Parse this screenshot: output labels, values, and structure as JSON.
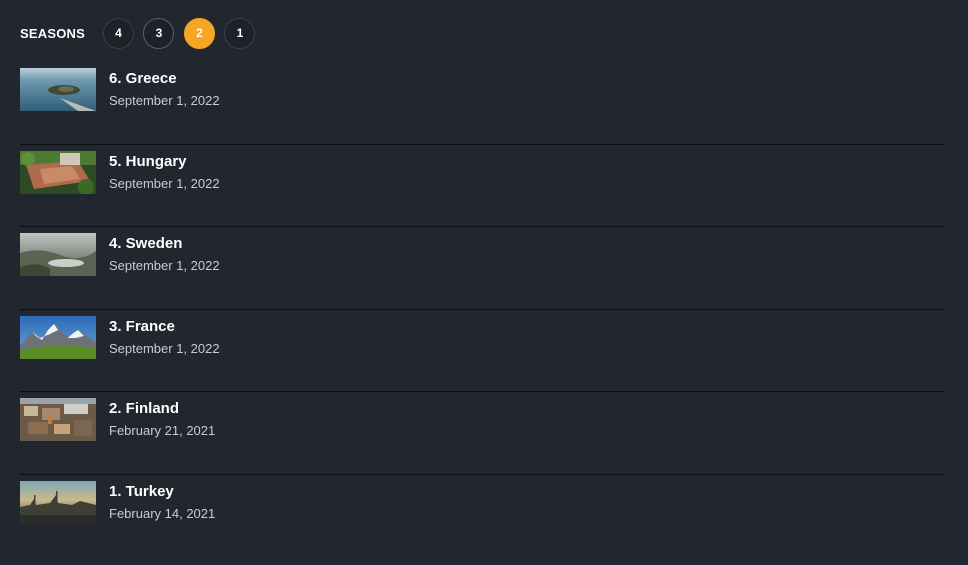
{
  "seasons": {
    "label": "SEASONS",
    "items": [
      "4",
      "3",
      "2",
      "1"
    ],
    "active": "2"
  },
  "episodes": [
    {
      "title": "6. Greece",
      "date": "September 1, 2022",
      "thumb_icon": "aerial-island-sea"
    },
    {
      "title": "5. Hungary",
      "date": "September 1, 2022",
      "thumb_icon": "forest-building"
    },
    {
      "title": "4. Sweden",
      "date": "September 1, 2022",
      "thumb_icon": "foggy-valley"
    },
    {
      "title": "3. France",
      "date": "September 1, 2022",
      "thumb_icon": "mountains-meadow"
    },
    {
      "title": "2. Finland",
      "date": "February 21, 2021",
      "thumb_icon": "city-aerial"
    },
    {
      "title": "1. Turkey",
      "date": "February 14, 2021",
      "thumb_icon": "sunset-skyline"
    }
  ],
  "colors": {
    "background": "#22262e",
    "accent": "#f5a623",
    "divider": "#0e1014"
  }
}
